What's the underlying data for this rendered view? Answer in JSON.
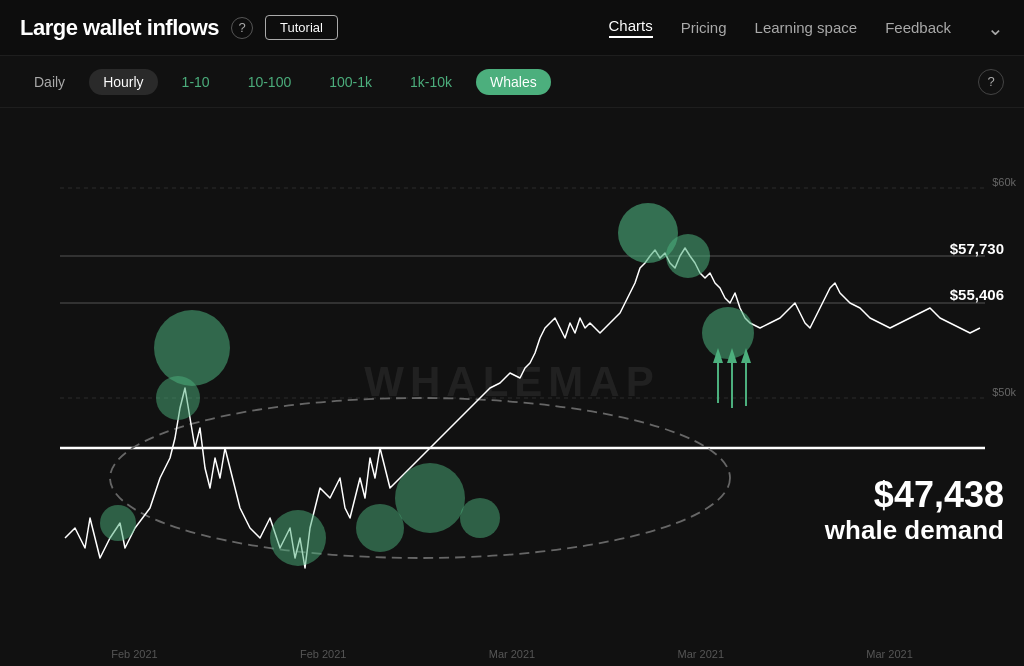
{
  "header": {
    "title": "Large wallet inflows",
    "help_label": "?",
    "tutorial_label": "Tutorial",
    "nav": [
      {
        "label": "Charts",
        "active": true
      },
      {
        "label": "Pricing",
        "active": false
      },
      {
        "label": "Learning space",
        "active": false
      },
      {
        "label": "Feedback",
        "active": false
      }
    ]
  },
  "subheader": {
    "filters": [
      {
        "label": "Daily",
        "state": "normal"
      },
      {
        "label": "Hourly",
        "state": "active-dark"
      },
      {
        "label": "1-10",
        "state": "green-text"
      },
      {
        "label": "10-100",
        "state": "green-text"
      },
      {
        "label": "100-1k",
        "state": "green-text"
      },
      {
        "label": "1k-10k",
        "state": "green-text"
      },
      {
        "label": "Whales",
        "state": "active-green"
      }
    ],
    "help_label": "?"
  },
  "chart": {
    "watermark": "WHALEMAP",
    "price_levels": [
      {
        "label": "$57,730",
        "position": "top"
      },
      {
        "label": "$55,406",
        "position": "mid"
      }
    ],
    "demand": {
      "price": "$47,438",
      "text": "whale demand"
    },
    "y_axis": [
      {
        "label": "$60k",
        "pct": 10
      },
      {
        "label": "$50k",
        "pct": 50
      }
    ],
    "x_axis": [
      "Feb 2021",
      "Feb 2021",
      "Mar 2021",
      "Mar 2021",
      "Mar 2021"
    ],
    "accent_color": "#4caf7d"
  }
}
